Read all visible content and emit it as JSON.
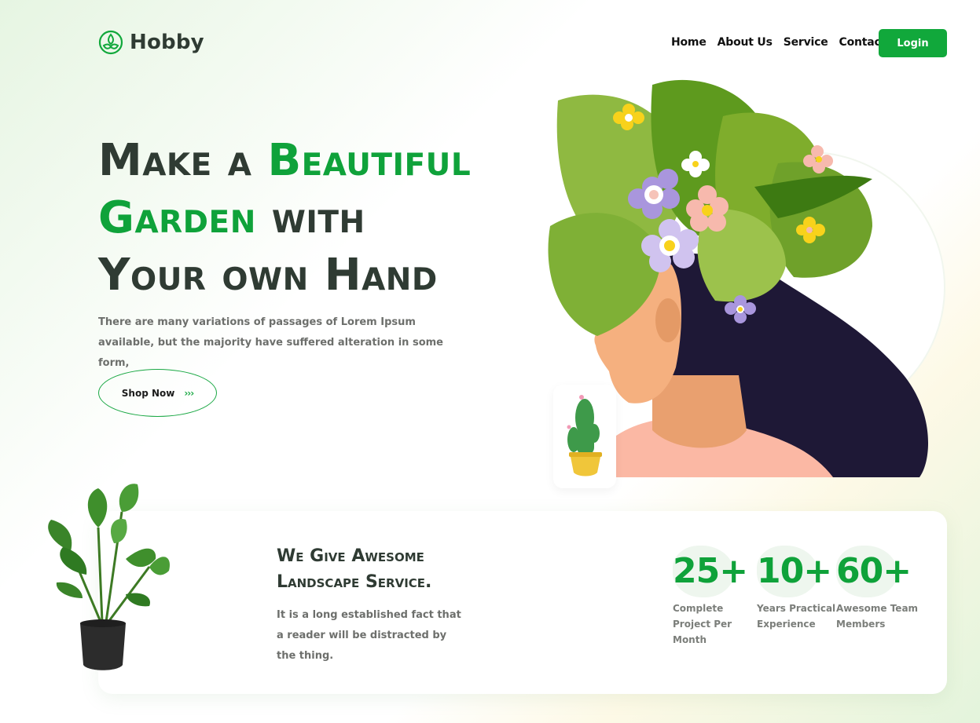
{
  "brand": {
    "name": "Hobby",
    "logo_icon": "leaf-flower-icon"
  },
  "nav": {
    "items": [
      "Home",
      "About Us",
      "Service",
      "Contact"
    ],
    "login_label": "Login"
  },
  "hero": {
    "title_lines": [
      [
        "Make a ",
        "Beautiful"
      ],
      [
        "Garden",
        " with"
      ],
      [
        "Your own Hand",
        ""
      ]
    ],
    "description": "There are many variations of passages of Lorem Ipsum available, but the majority have suffered alteration in some form,",
    "cta_label": "Shop Now",
    "cta_icon": "double-chevron-right-icon"
  },
  "service": {
    "title_line1": "We Give Awesome",
    "title_line2": "Landscape Service.",
    "description": "It is a long established fact that a reader will be distracted by the thing.",
    "stats": [
      {
        "value": "25+",
        "label": "Complete Project Per Month"
      },
      {
        "value": "10+",
        "label": "Years Practical Experience"
      },
      {
        "value": "60+",
        "label": "Awesome Team Members"
      }
    ]
  },
  "colors": {
    "accent": "#0fa23a",
    "heading": "#2f3b33",
    "muted": "#6d6f6c"
  }
}
